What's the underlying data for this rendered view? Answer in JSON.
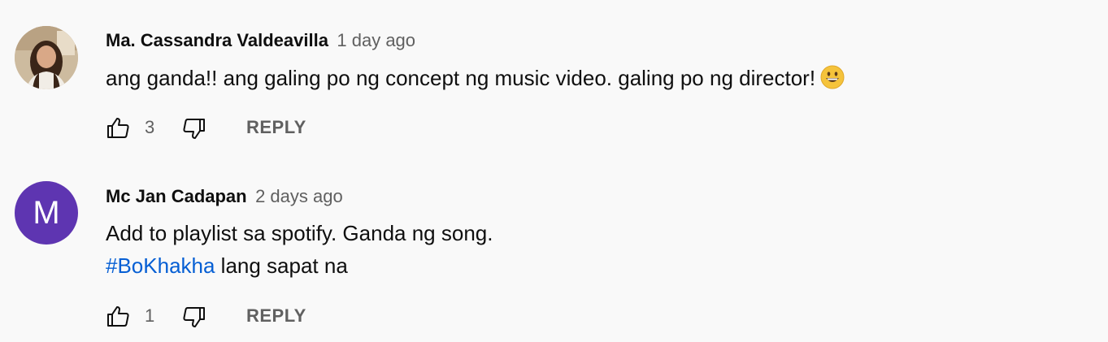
{
  "comments": [
    {
      "author": "Ma. Cassandra Valdeavilla",
      "time": "1 day ago",
      "text": "ang ganda!! ang galing po ng concept ng music video. galing po ng director!",
      "emoji": "grinning-face",
      "likes": "3",
      "reply_label": "REPLY"
    },
    {
      "author": "Mc Jan Cadapan",
      "time": "2 days ago",
      "avatar_letter": "M",
      "avatar_color": "#5e35b1",
      "line1": "Add to playlist sa spotify. Ganda ng song.",
      "hashtag": "#BoKhakha",
      "line2_rest": " lang sapat na",
      "likes": "1",
      "reply_label": "REPLY"
    }
  ],
  "colors": {
    "background": "#f9f9f9",
    "text": "#0f0f0f",
    "secondary": "#606060",
    "link": "#065fd4"
  }
}
